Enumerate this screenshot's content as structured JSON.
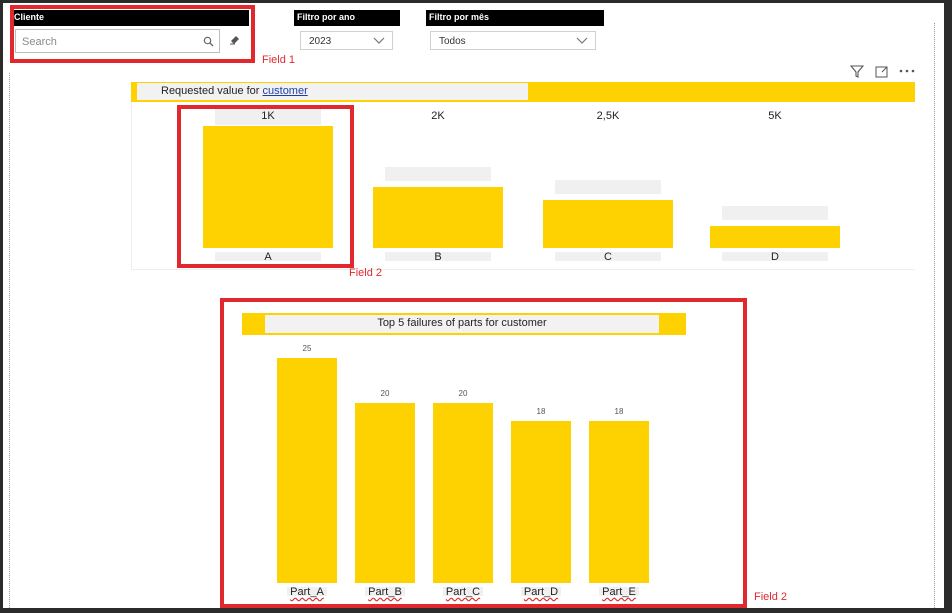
{
  "slicers": {
    "cliente": {
      "header": "Cliente",
      "placeholder": "Search"
    },
    "ano": {
      "header": "Filtro por ano",
      "value": "2023"
    },
    "mes": {
      "header": "Filtro por mês",
      "value": "Todos"
    }
  },
  "annotations": {
    "field1": "Field 1",
    "field2_a": "Field 2",
    "field2_b": "Field 2"
  },
  "chart1": {
    "title_prefix": "Requested value for ",
    "title_link": "customer",
    "chart_data": {
      "type": "bar",
      "categories": [
        "A",
        "B",
        "C",
        "D"
      ],
      "data_labels": [
        "1K",
        "2K",
        "2,5K",
        "5K"
      ],
      "values": [
        1000,
        2000,
        2500,
        5000
      ]
    }
  },
  "chart2": {
    "title": "Top 5 failures of parts for customer",
    "chart_data": {
      "type": "bar",
      "categories": [
        "Part_A",
        "Part_B",
        "Part_C",
        "Part_D",
        "Part_E"
      ],
      "values": [
        25,
        20,
        20,
        18,
        18
      ]
    }
  },
  "colors": {
    "bar": "#fdd200",
    "highlight": "#e0282e",
    "slicer_header": "#000000"
  },
  "icons": [
    "search-icon",
    "eraser-icon",
    "chevron-down-icon",
    "filter-icon",
    "focus-mode-icon",
    "more-options-icon"
  ]
}
